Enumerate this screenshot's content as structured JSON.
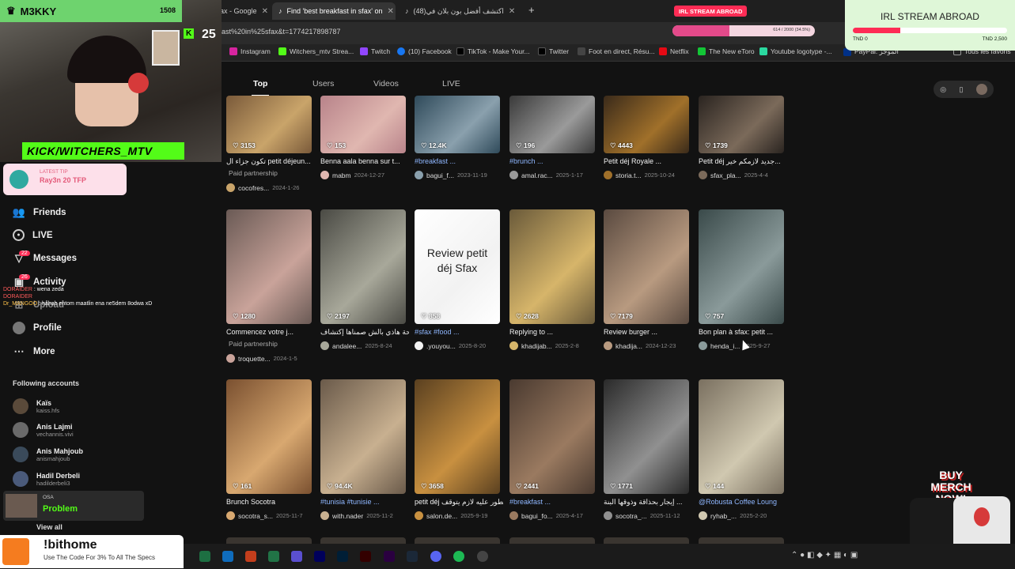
{
  "stream": {
    "name": "M3KKY",
    "kick_handle": "KICK/WITCHERS_MTV",
    "badge_count": "25"
  },
  "browser": {
    "tabs": [
      {
        "label": "eakfast in sfax - Google"
      },
      {
        "label": "Find 'best breakfast in sfax' on"
      },
      {
        "label": "(48)اكتشف أفضل بون بلان في"
      }
    ],
    "counter": "1508",
    "url": "ast%20in%25sfax&t=1774217898787",
    "bookmarks": [
      "Instagram",
      "Witchers_mtv Strea...",
      "Twitch",
      "(10) Facebook",
      "TikTok - Make Your...",
      "Twitter",
      "Foot en direct, Résu...",
      "Netflix",
      "The New eToro",
      "Youtube logotype -...",
      "PayPal: الموجز",
      "Tous les favoris"
    ]
  },
  "overlay": {
    "irl_title": "IRL STREAM ABROAD",
    "irl_small": "IRL STREAM ABROAD",
    "progress_pct": "614 / 2000 (34.5%)",
    "progress_fraction": 0.31,
    "tnd_start": "TND 0",
    "tnd_end": "TND 2,500",
    "tip_label": "LATEST TIP",
    "tip_value": "Ray3n 20 TFP",
    "chat": [
      {
        "user": "DORAIDER",
        "msg": "wena zeda"
      },
      {
        "user": "DORAIDER",
        "msg": ""
      },
      {
        "user": "Dr_MANGOO",
        "msg": "hahah entom maatlin ena ne5dem 8odwa xD"
      }
    ],
    "osa_label": "OSA",
    "osa_value": "Problem",
    "merch": "BUY MERCH NOW!",
    "sponsor_title": "!bithome",
    "sponsor_sub": "Use The Code For 3% To All The Specs"
  },
  "sidebar": {
    "nav": [
      {
        "label": "Friends",
        "icon": "friends-icon"
      },
      {
        "label": "LIVE",
        "icon": "live-icon"
      },
      {
        "label": "Messages",
        "icon": "messages-icon",
        "badge": "22"
      },
      {
        "label": "Activity",
        "icon": "activity-icon",
        "badge": "26"
      },
      {
        "label": "Upload",
        "icon": "upload-icon"
      },
      {
        "label": "Profile",
        "icon": "profile-icon"
      },
      {
        "label": "More",
        "icon": "more-icon"
      }
    ],
    "following_title": "Following accounts",
    "following": [
      {
        "name": "Kaïs",
        "handle": "kaiss.hfs"
      },
      {
        "name": "Anis Lajmi",
        "handle": "vechannis.vivi"
      },
      {
        "name": "Anis Mahjoub",
        "handle": "anismahjoub"
      },
      {
        "name": "Hadil Derbeli",
        "handle": "hadilderbeli3"
      }
    ],
    "view_all": "View all"
  },
  "content_tabs": [
    "Top",
    "Users",
    "Videos",
    "LIVE"
  ],
  "videos": [
    {
      "likes": "3153",
      "caption": "تكون جزاء ال petit déjeun...",
      "paid": "Paid partnership",
      "author": "cocofres...",
      "date": "2024-1-26",
      "c1": "#7a5a3a",
      "c2": "#c9a46a"
    },
    {
      "likes": "153",
      "caption": "Benna aala benna sur t...",
      "author": "mabm",
      "date": "2024-12-27",
      "c1": "#b8838a",
      "c2": "#e0b7b0"
    },
    {
      "likes": "12.4K",
      "caption": "#breakfast ...",
      "author": "bagui_f...",
      "date": "2023-11-19",
      "c1": "#2f4a5a",
      "c2": "#8aa0ad"
    },
    {
      "likes": "196",
      "caption": "#brunch ...",
      "author": "amal.rac...",
      "date": "2025-1-17",
      "c1": "#3a3a3a",
      "c2": "#9a9a9a"
    },
    {
      "likes": "4443",
      "caption": "Petit déj Royale ...",
      "author": "storia.t...",
      "date": "2025-10-24",
      "c1": "#3a2a1a",
      "c2": "#a0702a"
    },
    {
      "likes": "1739",
      "caption": "Petit déj جديد لازمكم خير...",
      "author": "sfax_pla...",
      "date": "2025-4-4",
      "c1": "#2a2420",
      "c2": "#7b6a5a"
    },
    {
      "likes": "1280",
      "caption": "Commencez votre j...",
      "paid": "Paid partnership",
      "author": "troquette...",
      "date": "2024-1-5",
      "c1": "#6a5a55",
      "c2": "#c9a39a"
    },
    {
      "likes": "2197",
      "caption": "والصباحة هاذي بالش صمناها إكتشاف...",
      "author": "andalee...",
      "date": "2025-8-24",
      "c1": "#4a4a44",
      "c2": "#a8a89a"
    },
    {
      "likes": "858",
      "caption": "#sfax #food ...",
      "author": ".youyou...",
      "date": "2025-8-20",
      "c1": "#ffffff",
      "c2": "#f2f2f2",
      "overlay_text": "Review petit déj Sfax"
    },
    {
      "likes": "2628",
      "caption": "Replying to ...",
      "author": "khadijab...",
      "date": "2025-2-8",
      "c1": "#6a5a3a",
      "c2": "#d6b56a"
    },
    {
      "likes": "7179",
      "caption": "Review burger ...",
      "author": "khadija...",
      "date": "2024-12-23",
      "c1": "#5a4a40",
      "c2": "#b89a80"
    },
    {
      "likes": "757",
      "caption": "Bon plan à sfax: petit ...",
      "author": "henda_i...",
      "date": "2025-9-27",
      "c1": "#3a4a4a",
      "c2": "#8a9a9a"
    },
    {
      "likes": "161",
      "caption": "Brunch Socotra",
      "author": "socotra_s...",
      "date": "2025-11-7",
      "c1": "#7a5030",
      "c2": "#d8a870"
    },
    {
      "likes": "94.4K",
      "caption": "#tunisia #tunisie ...",
      "author": "with.nader",
      "date": "2025-11-2",
      "c1": "#6a5a4a",
      "c2": "#c8b090"
    },
    {
      "likes": "3658",
      "caption": "petit déj هذا فطور عليه لازم يتوقف ...",
      "author": "salon.de...",
      "date": "2025-9-19",
      "c1": "#5a4020",
      "c2": "#c89040"
    },
    {
      "likes": "2441",
      "caption": "#breakfast ...",
      "author": "bagui_fo...",
      "date": "2025-4-17",
      "c1": "#4a3a30",
      "c2": "#9a7a60"
    },
    {
      "likes": "1771",
      "caption": "إيجار بحذاقة وذوقها البنة ...",
      "author": "socotra_...",
      "date": "2025-11-12",
      "c1": "#2a2a2a",
      "c2": "#909090"
    },
    {
      "likes": "144",
      "caption": "@Robusta Coffee Loung",
      "author": "ryhab_...",
      "date": "2025-2-20",
      "c1": "#7a7060",
      "c2": "#d0c8b0"
    }
  ]
}
